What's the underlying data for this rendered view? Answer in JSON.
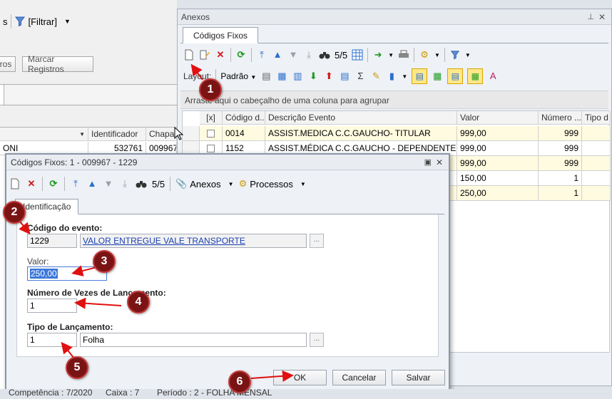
{
  "background_app": {
    "toolbar": {
      "left_fragment": "s",
      "filter_label": "[Filtrar]"
    },
    "buttons": {
      "registros_fragment": "ros",
      "marcar_label": "Marcar Registros"
    },
    "grid": {
      "headers": [
        "Identificador",
        "Chapa"
      ],
      "row_fragment": "ONI",
      "row_values": [
        "532761",
        "009967"
      ]
    },
    "status": {
      "competencia": "Competência : 7/2020",
      "caixa": "Caixa : 7",
      "periodo": "Período : 2 - FOLHA MENSAL"
    }
  },
  "anexos_panel": {
    "title": "Anexos",
    "tab": "Códigos Fixos",
    "record_counter": "5/5",
    "layout_label": "Layout:",
    "padrao_label": "Padrão",
    "group_hint": "Arraste aqui o cabeçalho de uma coluna para agrupar",
    "table": {
      "headers": [
        "[x]",
        "Código d...",
        "Descrição Evento",
        "Valor",
        "Número ...",
        "Tipo d"
      ],
      "rows": [
        {
          "codigo": "0014",
          "descricao": "ASSIST.MEDICA C.C.GAUCHO- TITULAR",
          "valor": "999,00",
          "numero": "999"
        },
        {
          "codigo": "1152",
          "descricao": "ASSIST.MÉDICA C.C.GAUCHO - DEPENDENTE",
          "valor": "999,00",
          "numero": "999"
        },
        {
          "codigo": "",
          "descricao": "",
          "valor": "999,00",
          "numero": "999"
        },
        {
          "codigo": "",
          "descricao": "",
          "valor": "150,00",
          "numero": "1"
        },
        {
          "codigo": "",
          "descricao": "",
          "valor": "250,00",
          "numero": "1"
        }
      ]
    }
  },
  "dialog": {
    "title": "Códigos Fixos: 1 - 009967 - 1229",
    "record_counter": "5/5",
    "anexos_label": "Anexos",
    "processos_label": "Processos",
    "tab": "Identificação",
    "fields": {
      "codigo_evento_label": "Código do evento:",
      "codigo_evento_value": "1229",
      "codigo_evento_desc": "VALOR ENTREGUE VALE TRANSPORTE",
      "valor_label": "Valor:",
      "valor_value": "250,00",
      "numero_vezes_label": "Número de Vezes de Lançamento:",
      "numero_vezes_value": "1",
      "tipo_lancamento_label": "Tipo de Lançamento:",
      "tipo_lancamento_value": "1",
      "tipo_lancamento_desc": "Folha",
      "ellipsis": "..."
    },
    "buttons": {
      "ok": "OK",
      "cancel": "Cancelar",
      "save": "Salvar"
    }
  },
  "annotations": [
    "1",
    "2",
    "3",
    "4",
    "5",
    "6"
  ],
  "colors": {
    "annotation_fill": "#7a1414",
    "arrow": "#e01010",
    "highlight_row": "#fffbe0",
    "link": "#1a3fb0"
  }
}
